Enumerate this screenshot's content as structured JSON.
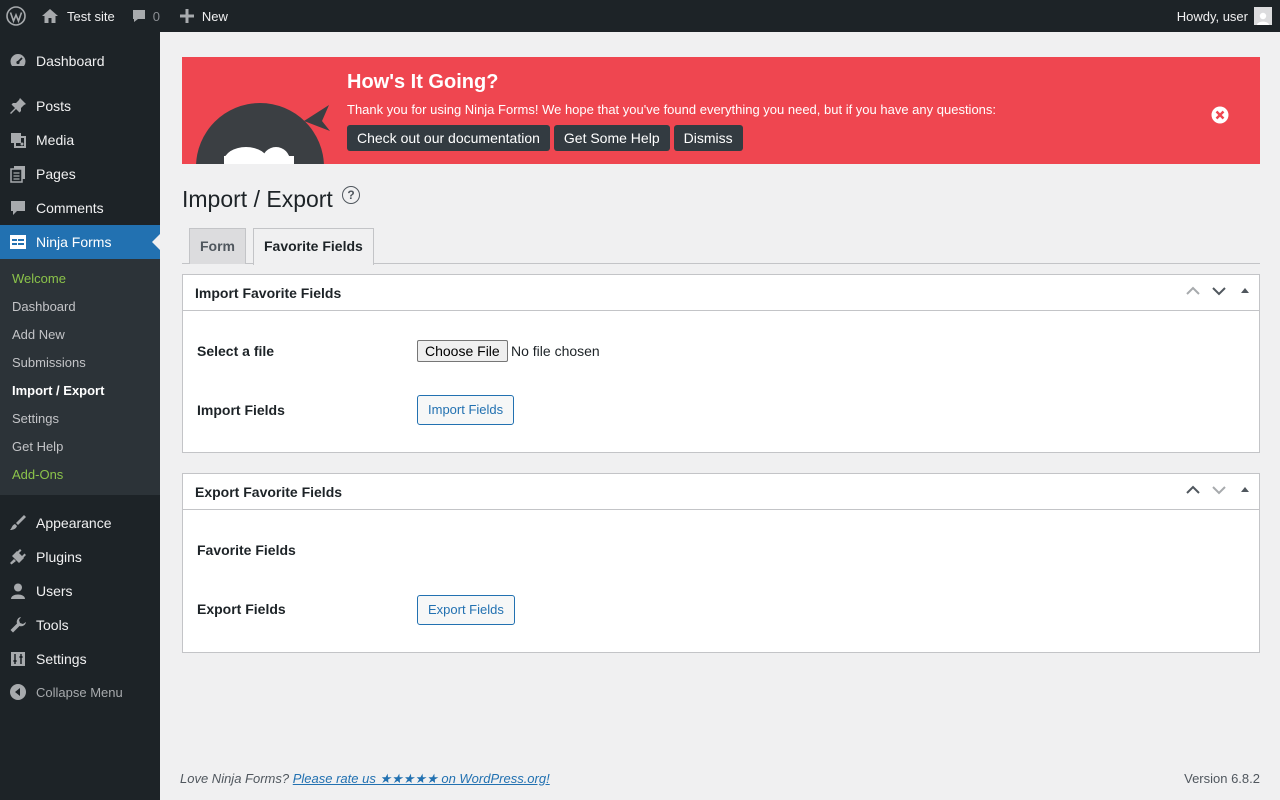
{
  "adminbar": {
    "site_name": "Test site",
    "comments_count": "0",
    "new_label": "New",
    "greeting": "Howdy, user"
  },
  "sidebar": {
    "items": [
      {
        "label": "Dashboard",
        "icon": "dashboard-icon"
      },
      {
        "label": "Posts",
        "icon": "pin-icon"
      },
      {
        "label": "Media",
        "icon": "media-icon"
      },
      {
        "label": "Pages",
        "icon": "pages-icon"
      },
      {
        "label": "Comments",
        "icon": "comment-icon"
      },
      {
        "label": "Ninja Forms",
        "icon": "forms-icon"
      },
      {
        "label": "Appearance",
        "icon": "brush-icon"
      },
      {
        "label": "Plugins",
        "icon": "plug-icon"
      },
      {
        "label": "Users",
        "icon": "user-icon"
      },
      {
        "label": "Tools",
        "icon": "wrench-icon"
      },
      {
        "label": "Settings",
        "icon": "settings-icon"
      }
    ],
    "submenu": [
      "Welcome",
      "Dashboard",
      "Add New",
      "Submissions",
      "Import / Export",
      "Settings",
      "Get Help",
      "Add-Ons"
    ],
    "collapse_label": "Collapse Menu"
  },
  "notice": {
    "title": "How's It Going?",
    "text": "Thank you for using Ninja Forms! We hope that you've found everything you need, but if you have any questions:",
    "buttons": [
      "Check out our documentation",
      "Get Some Help",
      "Dismiss"
    ],
    "bg_color": "#ef4650"
  },
  "page": {
    "title": "Import / Export",
    "tabs": [
      "Form",
      "Favorite Fields"
    ]
  },
  "import_panel": {
    "title": "Import Favorite Fields",
    "select_label": "Select a file",
    "choose_file": "Choose File",
    "file_status": "No file chosen",
    "import_label": "Import Fields",
    "import_button": "Import Fields"
  },
  "export_panel": {
    "title": "Export Favorite Fields",
    "favorites_label": "Favorite Fields",
    "export_label": "Export Fields",
    "export_button": "Export Fields"
  },
  "footer": {
    "love_text": "Love Ninja Forms?",
    "rate_link": "Please rate us ★★★★★ on WordPress.org!",
    "version": "Version 6.8.2"
  }
}
